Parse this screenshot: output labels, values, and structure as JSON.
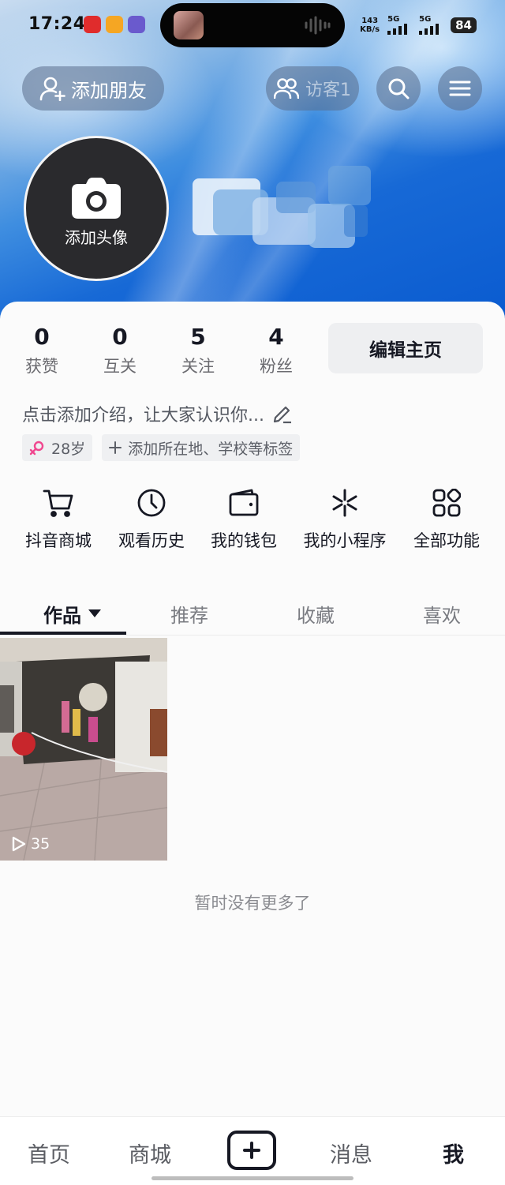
{
  "status_bar": {
    "time": "17:24",
    "net_speed_value": "143",
    "net_speed_unit": "KB/s",
    "sim1": "5G",
    "sim2": "5G",
    "battery": "84"
  },
  "header": {
    "add_friend_label": "添加朋友",
    "visitor_label": "访客1",
    "add_avatar_label": "添加头像"
  },
  "stats": [
    {
      "value": "0",
      "label": "获赞"
    },
    {
      "value": "0",
      "label": "互关"
    },
    {
      "value": "5",
      "label": "关注"
    },
    {
      "value": "4",
      "label": "粉丝"
    }
  ],
  "edit_profile_label": "编辑主页",
  "bio_placeholder": "点击添加介绍，让大家认识你...",
  "tags": {
    "age": "28岁",
    "add_tags": "添加所在地、学校等标签"
  },
  "quick_actions": [
    {
      "label": "抖音商城",
      "icon": "cart-icon"
    },
    {
      "label": "观看历史",
      "icon": "clock-icon"
    },
    {
      "label": "我的钱包",
      "icon": "wallet-icon"
    },
    {
      "label": "我的小程序",
      "icon": "mini-program-icon"
    },
    {
      "label": "全部功能",
      "icon": "grid-icon"
    }
  ],
  "tabs": [
    {
      "label": "作品",
      "active": true
    },
    {
      "label": "推荐"
    },
    {
      "label": "收藏"
    },
    {
      "label": "喜欢"
    }
  ],
  "video": {
    "play_count": "35"
  },
  "empty_text": "暂时没有更多了",
  "bottom_nav": [
    {
      "label": "首页"
    },
    {
      "label": "商城"
    },
    {
      "label": "消息"
    },
    {
      "label": "我",
      "active": true
    }
  ]
}
